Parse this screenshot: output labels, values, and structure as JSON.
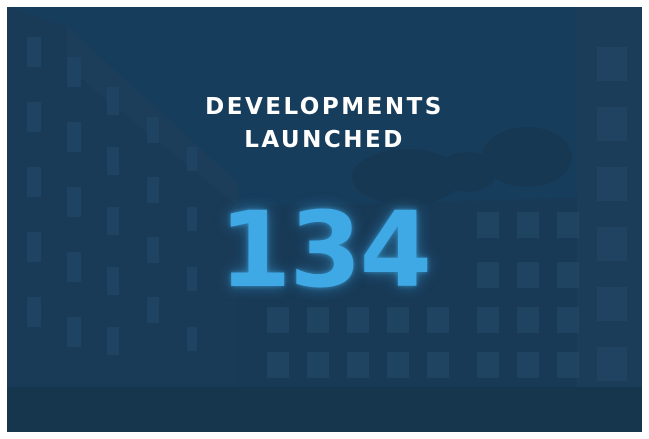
{
  "stat_card": {
    "heading_line1": "DEVELOPMENTS",
    "heading_line2": "LAUNCHED",
    "value": "134"
  },
  "colors": {
    "background": "#15344f",
    "overlay": "#143e60",
    "heading_text": "#ffffff",
    "value_text": "#3fa9e6"
  }
}
